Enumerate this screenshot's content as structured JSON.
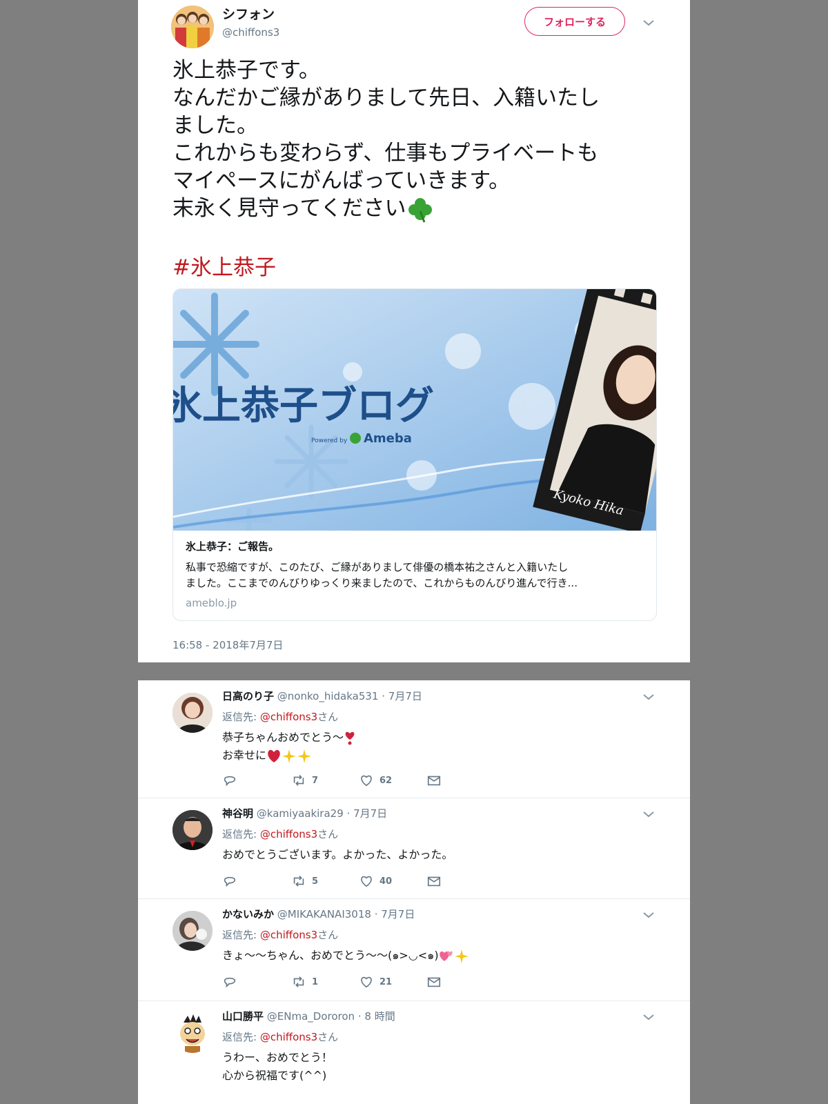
{
  "tweet": {
    "display_name": "シフォン",
    "handle": "@chiffons3",
    "follow_label": "フォローする",
    "text": "氷上恭子です。\nなんだかご縁がありまして先日、入籍いたし\nました。\nこれからも変わらず、仕事もプライベートも\nマイペースにがんばっていきます。\n末永く見守ってください",
    "text_emoji": "clover-emoji",
    "hashtag": "#氷上恭子",
    "card": {
      "image_title": "氷上恭子ブログ",
      "powered_by": "Powered by",
      "ameba": "Ameba",
      "signature": "Kyoko Hika",
      "title": "氷上恭子：ご報告。",
      "description": "私事で恐縮ですが、このたび、ご縁がありまして俳優の橋本祐之さんと入籍いたし\nました。ここまでのんびりゆっくり来ましたので、これからものんびり進んで行き...",
      "domain": "ameblo.jp"
    },
    "timestamp": "16:58 - 2018年7月7日"
  },
  "replies": [
    {
      "name": "日高のり子",
      "handle": "@nonko_hidaka531",
      "date": "· 7月7日",
      "reply_to_prefix": "返信先: ",
      "reply_to_mention": "@chiffons3",
      "reply_to_suffix": "さん",
      "line1": "恭子ちゃんおめでとう～",
      "line2": "お幸せに",
      "retweets": "7",
      "likes": "62"
    },
    {
      "name": "神谷明",
      "handle": "@kamiyaakira29",
      "date": "· 7月7日",
      "reply_to_prefix": "返信先: ",
      "reply_to_mention": "@chiffons3",
      "reply_to_suffix": "さん",
      "line1": "おめでとうございます。よかった、よかった。",
      "retweets": "5",
      "likes": "40"
    },
    {
      "name": "かないみか",
      "handle": "@MIKAKANAI3018",
      "date": "· 7月7日",
      "reply_to_prefix": "返信先: ",
      "reply_to_mention": "@chiffons3",
      "reply_to_suffix": "さん",
      "line1": "きょ～～ちゃん、おめでとう～～(๑>◡<๑)",
      "retweets": "1",
      "likes": "21"
    },
    {
      "name": "山口勝平",
      "handle": "@ENma_Dororon",
      "date": "· 8 時間",
      "reply_to_prefix": "返信先: ",
      "reply_to_mention": "@chiffons3",
      "reply_to_suffix": "さん",
      "line1": "うわー、おめでとう！",
      "line2": "心から祝福です(^^)"
    }
  ],
  "colors": {
    "accent": "#e0245e",
    "mention": "#c0181e",
    "muted": "#657786",
    "background": "#7f7f7f"
  }
}
